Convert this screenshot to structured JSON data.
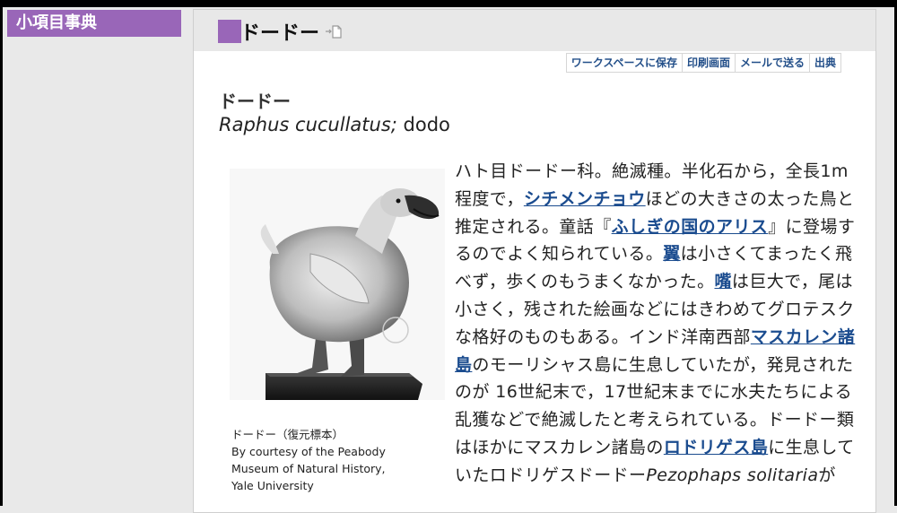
{
  "sidebar": {
    "title": "小項目事典"
  },
  "header": {
    "title": "ドードー"
  },
  "toolbar": {
    "save": "ワークスペースに保存",
    "print": "印刷画面",
    "mail": "メールで送る",
    "source": "出典"
  },
  "entry": {
    "title": "ドードー",
    "scientific_name": "Raphus cucullatus;",
    "english_name": "dodo"
  },
  "figure": {
    "caption_ja": "ドードー（復元標本）",
    "caption_line1": "By courtesy of the Peabody",
    "caption_line2": "Museum of Natural History,",
    "caption_line3": "Yale University"
  },
  "body": {
    "t1": "ハト目ドードー科。絶滅種。半化石から，全長1m程度で，",
    "link1": "シチメンチョウ",
    "t2": "ほどの大きさの太った鳥と推定される。童話『",
    "link2": "ふしぎの国のアリス",
    "t3": "』に登場するのでよく知られている。",
    "link3": "翼",
    "t4": "は小さくてまったく飛べず，歩くのもうまくなかった。",
    "link4": "嘴",
    "t5": "は巨大で，尾は小さく，残された絵画などにはきわめてグロテスクな格好のものもある。インド洋南西部",
    "link5": "マスカレン諸島",
    "t6": "のモーリシャス島に生息していたが，発見されたのが 16世紀末で，17世紀末までに水夫たちによる乱獲などで絶滅したと考えられている。ドードー類はほかにマスカレン諸島の",
    "link6": "ロドリゲス島",
    "t7": "に生息していたロドリゲスドードー",
    "sci2": "Pezophaps solitaria",
    "t8": "が"
  },
  "colors": {
    "accent": "#9966b8",
    "link": "#1b4c8f"
  },
  "icons": {
    "title_icon": "document-link-icon"
  }
}
